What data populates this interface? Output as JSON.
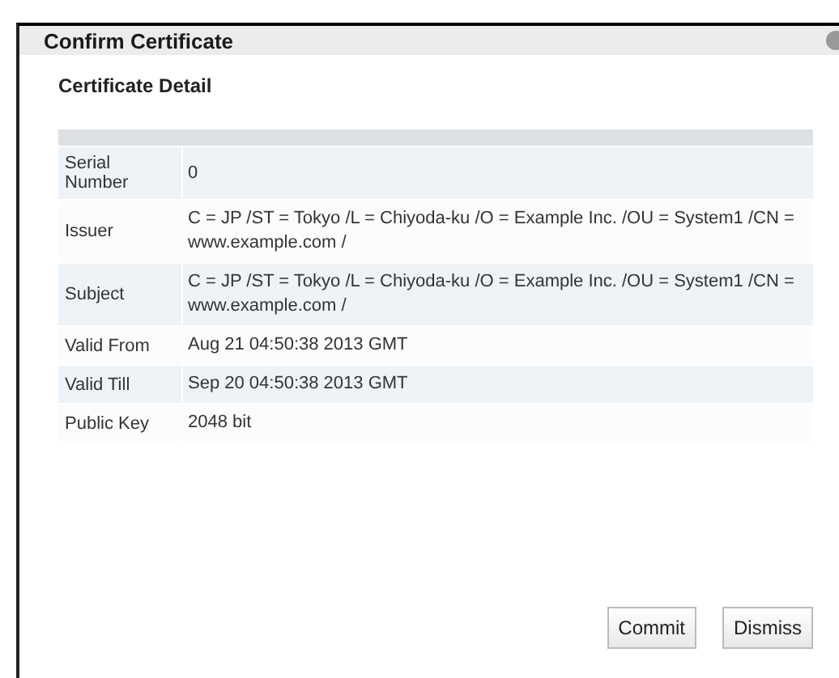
{
  "window": {
    "title": "Confirm Certificate"
  },
  "section_title": "Certificate Detail",
  "details": [
    {
      "label": "Serial Number",
      "value": "0"
    },
    {
      "label": "Issuer",
      "value": "C = JP /ST = Tokyo /L = Chiyoda-ku /O = Example Inc. /OU = System1 /CN = www.example.com /"
    },
    {
      "label": "Subject",
      "value": "C = JP /ST = Tokyo /L = Chiyoda-ku /O = Example Inc. /OU = System1 /CN = www.example.com /"
    },
    {
      "label": "Valid From",
      "value": "Aug 21 04:50:38 2013 GMT"
    },
    {
      "label": "Valid Till",
      "value": "Sep 20 04:50:38 2013 GMT"
    },
    {
      "label": "Public Key",
      "value": "2048 bit"
    }
  ],
  "buttons": [
    "Commit",
    "Dismiss"
  ]
}
